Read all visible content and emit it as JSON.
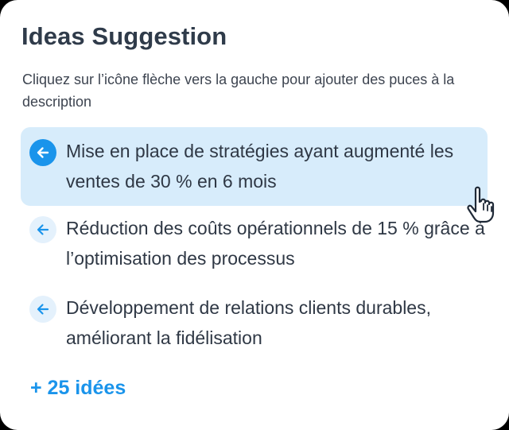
{
  "panel": {
    "title": "Ideas Suggestion",
    "subtitle": "Cliquez sur l’icône flèche vers la gauche pour ajouter des puces à la description"
  },
  "suggestions": [
    {
      "text": "Mise en place de stratégies ayant augmenté les ventes de 30 % en 6 mois",
      "icon": "arrow-left-icon",
      "active": true
    },
    {
      "text": "Réduction des coûts opérationnels de 15 % grâce à l’optimisation des processus",
      "icon": "arrow-left-icon",
      "active": false
    },
    {
      "text": "Développement de relations clients durables, améliorant la fidélisation",
      "icon": "arrow-left-icon",
      "active": false
    }
  ],
  "more_link": "+ 25 idées",
  "cursor_icon": "hand-pointer-icon",
  "colors": {
    "accent": "#1a94eb",
    "highlight": "#d7ecfb",
    "title": "#2f3b4a",
    "text": "#2f3845"
  }
}
